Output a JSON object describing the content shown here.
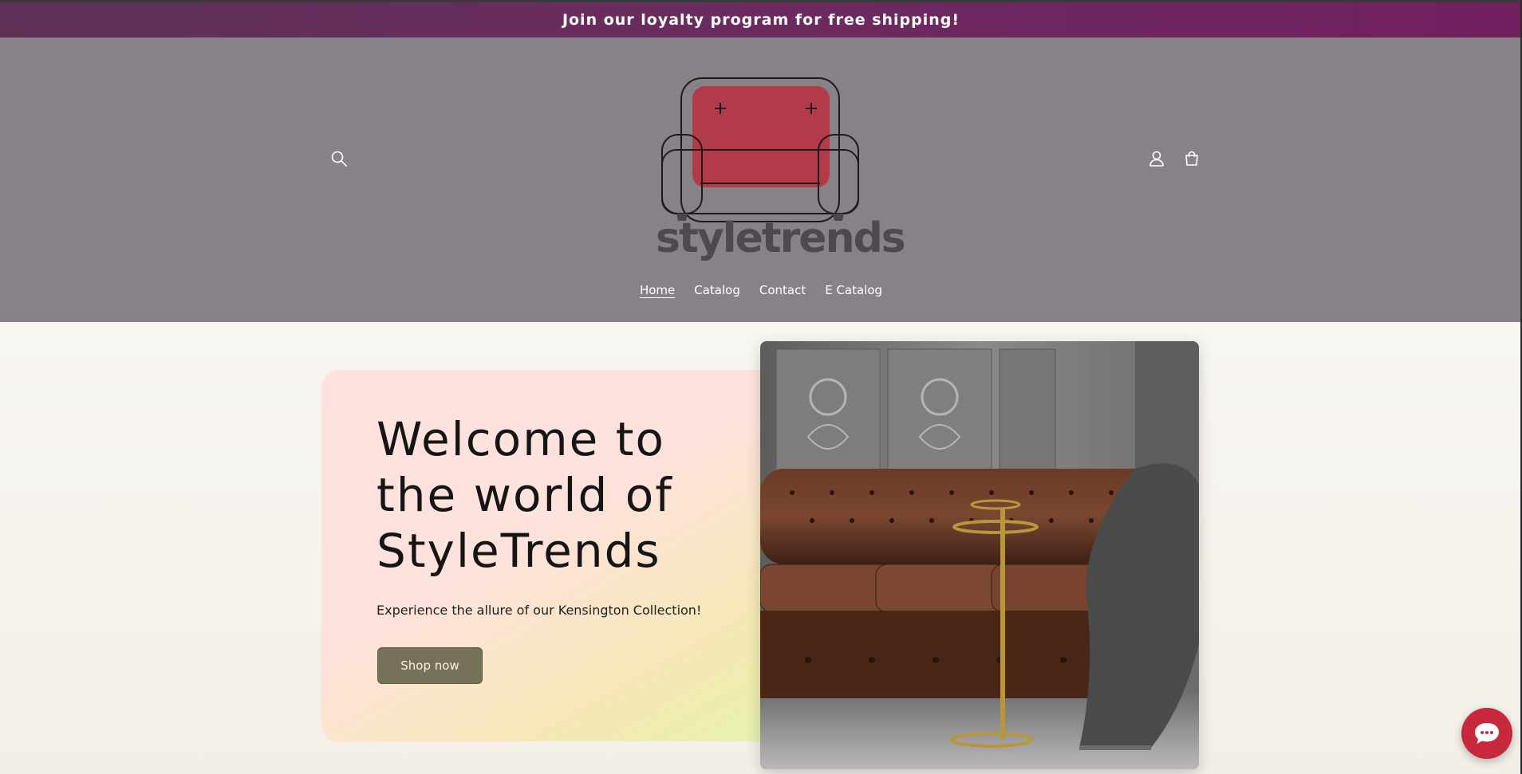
{
  "announcement": {
    "text": "Join our loyalty program for free shipping!"
  },
  "header": {
    "brand": "styletrends",
    "icons": {
      "search": "search-icon",
      "account": "account-icon",
      "cart": "cart-icon"
    },
    "logo_colors": {
      "cushion": "#b33a48",
      "outline": "#1e1b1e"
    }
  },
  "nav": {
    "items": [
      {
        "label": "Home",
        "active": true
      },
      {
        "label": "Catalog",
        "active": false
      },
      {
        "label": "Contact",
        "active": false
      },
      {
        "label": "E Catalog",
        "active": false
      }
    ]
  },
  "hero": {
    "title": "Welcome to the world of StyleTrends",
    "subtitle": "Experience the allure of our Kensington Collection!",
    "cta_label": "Shop now",
    "image_alt": "Brown leather Chesterfield sofa with grey throw and brass side table"
  },
  "chat": {
    "icon": "chat-icon",
    "color": "#c7283b"
  },
  "colors": {
    "announcement_bg": "#6b2b60",
    "header_bg": "#878288",
    "button_bg": "#767259"
  }
}
